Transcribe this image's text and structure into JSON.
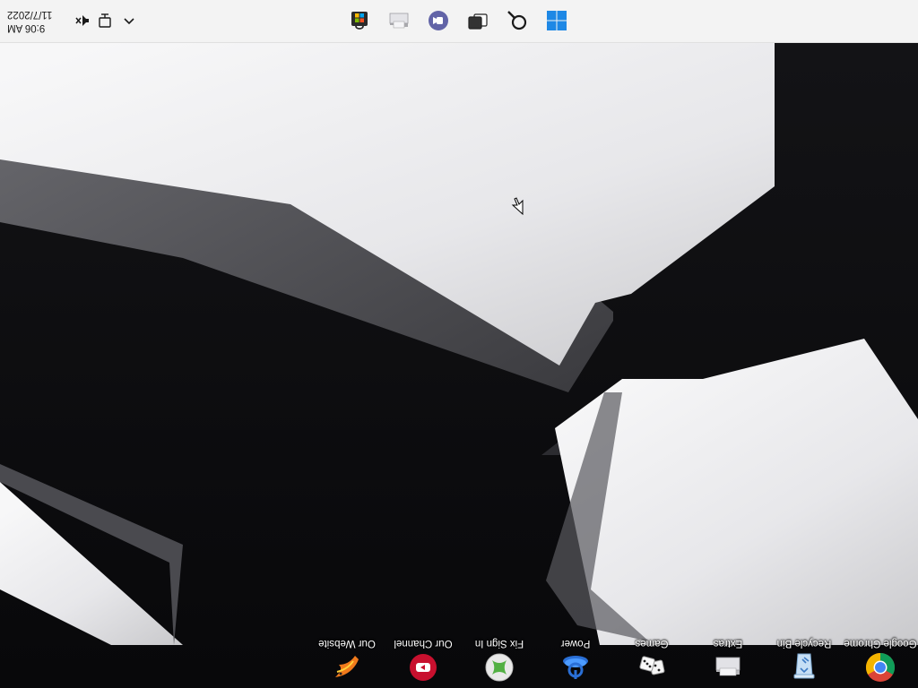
{
  "desktop": {
    "icons": [
      {
        "label": "Google Chrome",
        "icon": "chrome-icon"
      },
      {
        "label": "Recycle Bin",
        "icon": "recycle-bin-icon"
      },
      {
        "label": "Extras",
        "icon": "folder-icon"
      },
      {
        "label": "Games",
        "icon": "games-dice-icon"
      },
      {
        "label": "Power",
        "icon": "power-icon"
      },
      {
        "label": "Fix Sign In",
        "icon": "xbox-icon"
      },
      {
        "label": "Our Channel",
        "icon": "youtube-icon"
      },
      {
        "label": "Our Website",
        "icon": "website-bird-icon"
      }
    ]
  },
  "taskbar": {
    "buttons": [
      {
        "name": "start",
        "icon": "windows-logo-icon"
      },
      {
        "name": "search",
        "icon": "search-icon"
      },
      {
        "name": "task-view",
        "icon": "task-view-icon"
      },
      {
        "name": "teams-chat",
        "icon": "teams-chat-icon"
      },
      {
        "name": "file-explorer",
        "icon": "folder-icon"
      },
      {
        "name": "microsoft-store",
        "icon": "store-icon"
      }
    ],
    "tray": {
      "icons": [
        "chevron-up-icon",
        "network-icon",
        "volume-muted-icon"
      ],
      "time": "9:06 AM",
      "date": "11/7/2022"
    }
  },
  "colors": {
    "taskbar_bg": "#f3f3f3",
    "windows_blue": "#1e88e5",
    "teams_purple": "#6264a7"
  }
}
